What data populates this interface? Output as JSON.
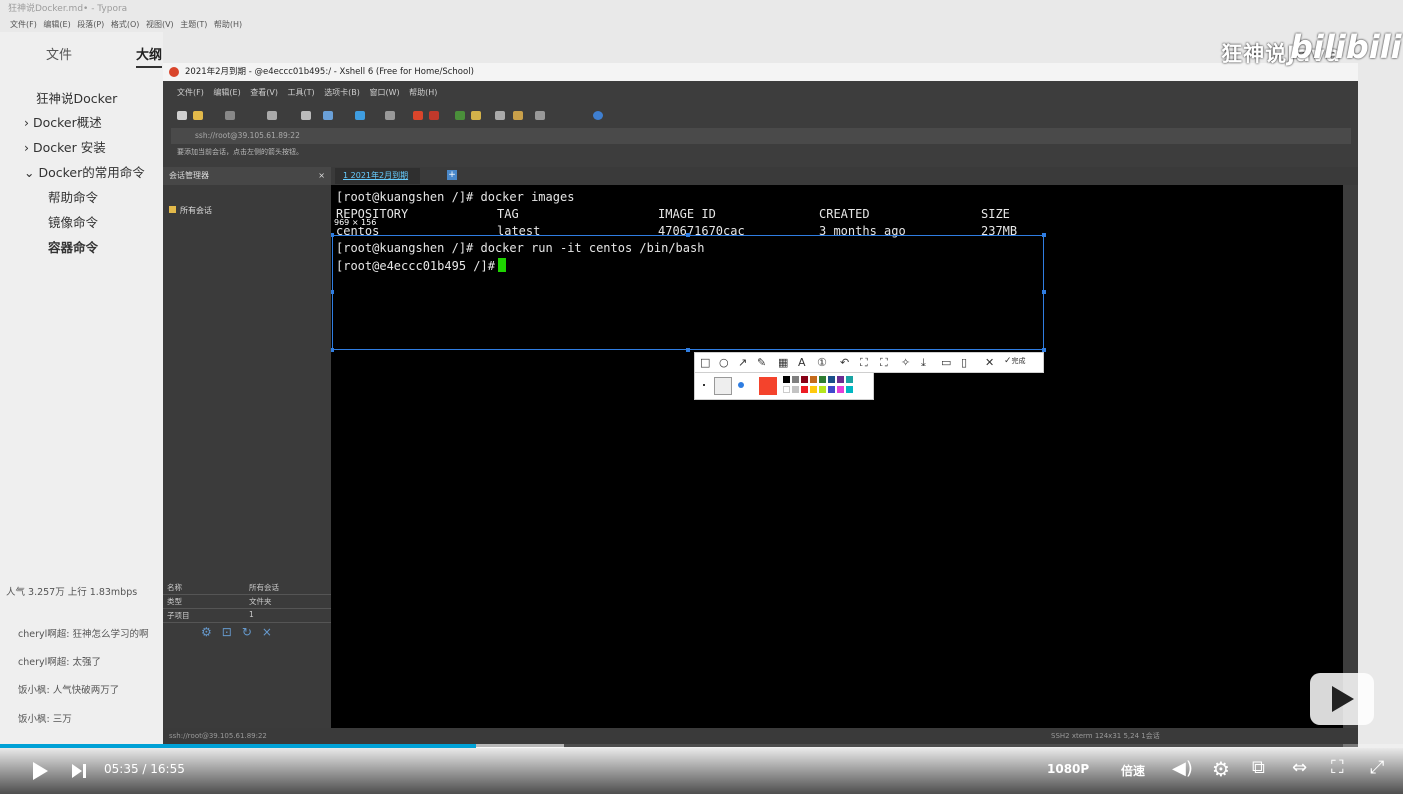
{
  "typora": {
    "title": "狂神说Docker.md• - Typora",
    "menu": [
      "文件(F)",
      "编辑(E)",
      "段落(P)",
      "格式(O)",
      "视图(V)",
      "主题(T)",
      "帮助(H)"
    ],
    "sidebar_tabs": {
      "files": "文件",
      "outline": "大纲"
    },
    "outline": [
      "狂神说Docker",
      "Docker概述",
      "Docker 安装",
      "Docker的常用命令",
      "帮助命令",
      "镜像命令",
      "容器命令"
    ]
  },
  "chat": {
    "stats": "人气 3.257万 上行 1.83mbps",
    "lines": [
      "cheryl啊超: 狂神怎么学习的啊",
      "cheryl啊超: 太强了",
      "饭小枫: 人气快破两万了",
      "饭小枫: 三万"
    ]
  },
  "xshell": {
    "title": "2021年2月到期 - @e4eccc01b495:/ - Xshell 6 (Free for Home/School)",
    "menu": [
      "文件(F)",
      "编辑(E)",
      "查看(V)",
      "工具(T)",
      "选项卡(B)",
      "窗口(W)",
      "帮助(H)"
    ],
    "address": "ssh://root@39.105.61.89:22",
    "hint": "要添加当前会话，点击左侧的箭头按钮。",
    "session_header": "会话管理器",
    "session_root": "所有会话",
    "session_tab": "1 2021年2月到期",
    "props": [
      {
        "k": "名称",
        "v": "所有会话"
      },
      {
        "k": "类型",
        "v": "文件夹"
      },
      {
        "k": "子项目",
        "v": "1"
      }
    ],
    "status_left": "ssh://root@39.105.61.89:22",
    "status_right": "SSH2   xterm   124x31   5,24   1会话"
  },
  "terminal": {
    "prompt1": "[root@kuangshen /]# docker images",
    "headers": [
      "REPOSITORY",
      "TAG",
      "IMAGE ID",
      "CREATED",
      "SIZE"
    ],
    "row": [
      "centos",
      "latest",
      "470671670cac",
      "3 months ago",
      "237MB"
    ],
    "prompt2": "[root@kuangshen /]# docker run -it centos /bin/bash",
    "prompt3": "[root@e4eccc01b495 /]#",
    "selection_size": "969 × 156"
  },
  "snip": {
    "done": "完成"
  },
  "overlay": {
    "brand": "狂神说Java",
    "bili": "bilibili"
  },
  "player": {
    "time": "05:35 / 16:55",
    "quality": "1080P",
    "speed": "倍速",
    "progress": 0.339,
    "buffered": 0.402
  }
}
